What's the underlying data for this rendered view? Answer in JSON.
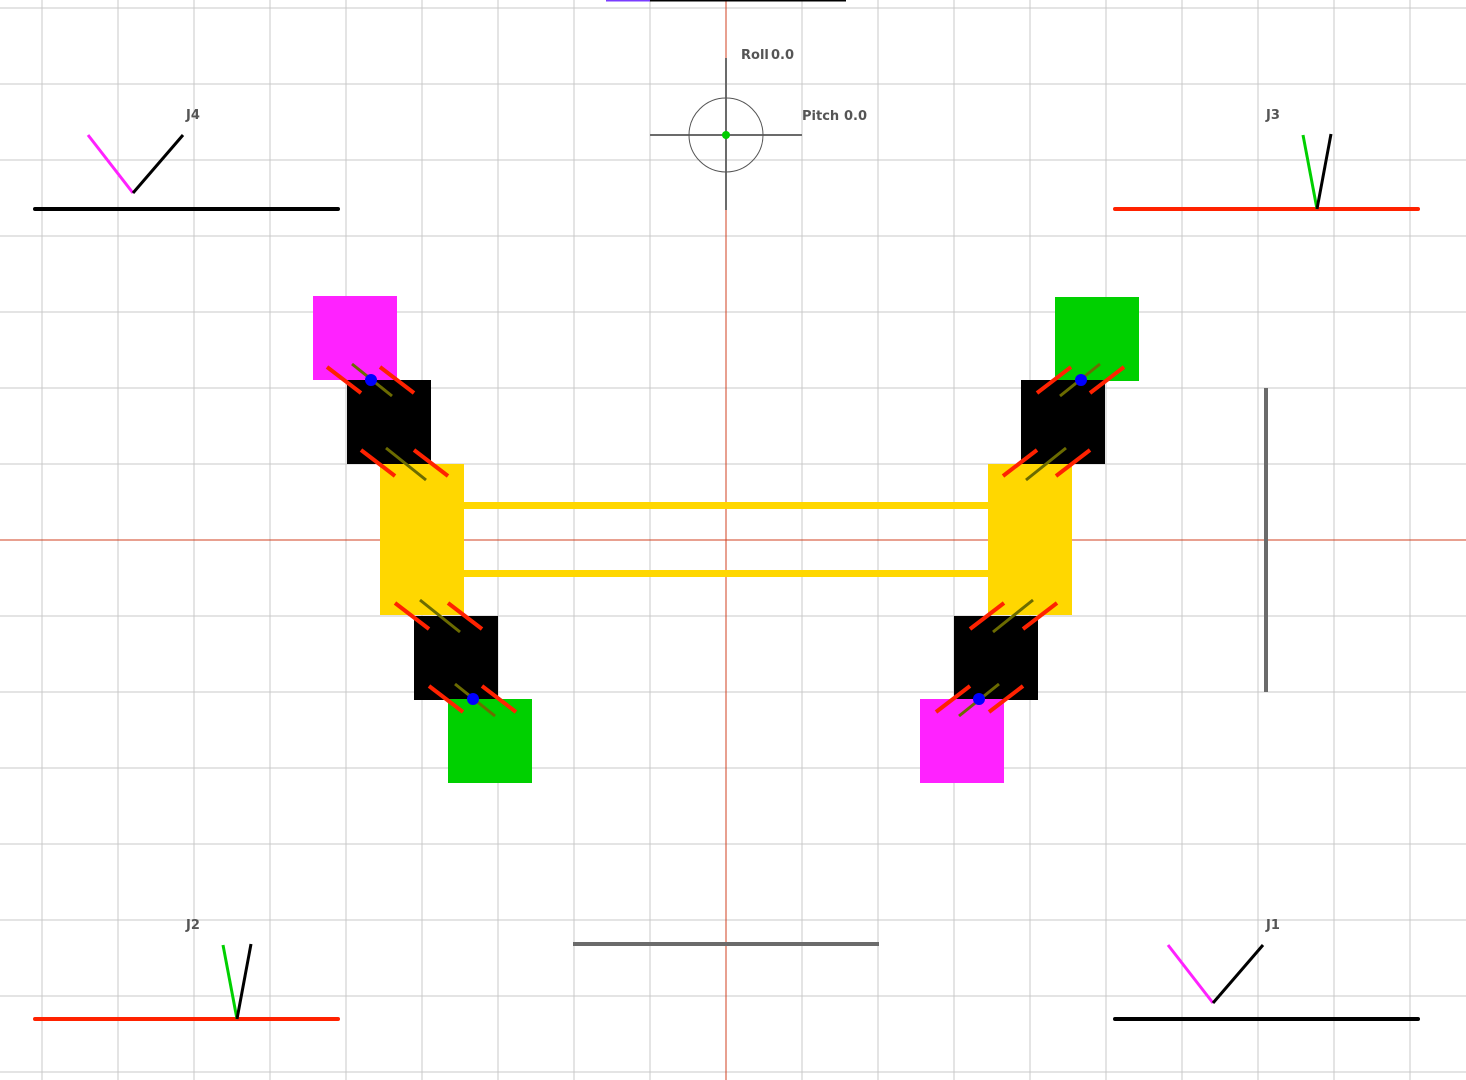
{
  "colors": {
    "background": "#ffffff",
    "grid": "#c8c8c8",
    "axis": "#d04020",
    "body": "#ffd700",
    "coxa": "#ff22ff",
    "femur": "#000000",
    "tibia": "#00d000",
    "servo_line": "#ff2200",
    "servo_horn": "#6b6b00",
    "joint": "#0000ff",
    "gauge": "#6b6b6b",
    "label": "#555555",
    "level_dot": "#00cc00",
    "ground_black": "#000000",
    "ground_red": "#ff2200"
  },
  "attitude": {
    "roll_label": "Roll",
    "roll_value": "0.0",
    "pitch_label": "Pitch",
    "pitch_value": "0.0"
  },
  "legs": [
    {
      "id": "j4",
      "label": "J4",
      "ground_color": "ground_black",
      "femur_color": "coxa",
      "tibia_color": "femur"
    },
    {
      "id": "j3",
      "label": "J3",
      "ground_color": "ground_red",
      "femur_color": "tibia",
      "tibia_color": "femur"
    },
    {
      "id": "j2",
      "label": "J2",
      "ground_color": "ground_red",
      "femur_color": "tibia",
      "tibia_color": "femur"
    },
    {
      "id": "j1",
      "label": "J1",
      "ground_color": "ground_black",
      "femur_color": "coxa",
      "tibia_color": "femur"
    }
  ]
}
